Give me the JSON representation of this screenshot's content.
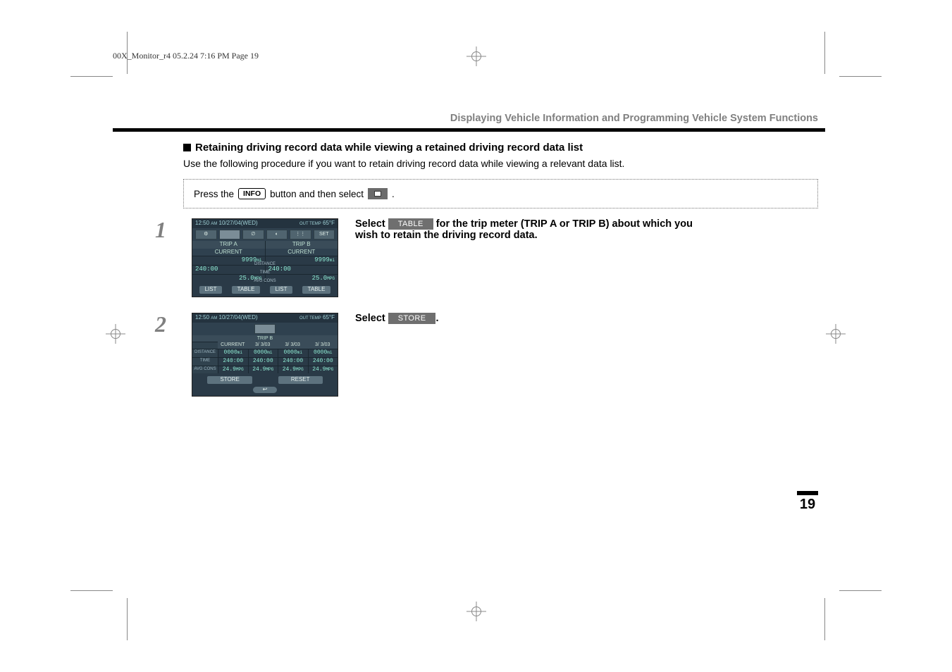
{
  "print_header": "00X_Monitor_r4  05.2.24  7:16 PM  Page 19",
  "chapter_title": "Displaying Vehicle Information and Programming Vehicle System Functions",
  "section_title": "Retaining driving record data while viewing a retained driving record data list",
  "section_intro": "Use the following procedure if you want to retain driving record data while viewing a relevant data list.",
  "instruction": {
    "pre": "Press the ",
    "info_label": "INFO",
    "mid": " button and then select ",
    "post": "."
  },
  "steps": [
    {
      "number": "1",
      "text_pre": "Select ",
      "button_label": "TABLE",
      "text_post_bold_1": " for the trip meter (TRIP A or TRIP B) about which you",
      "text_post_bold_2": "wish to retain the driving record data."
    },
    {
      "number": "2",
      "text_pre": "Select ",
      "button_label": "STORE",
      "text_post": "."
    }
  ],
  "screenshot1": {
    "time": "12:50",
    "ampm": "AM",
    "date": "10/27/04(WED)",
    "temp_label": "OUT TEMP",
    "temp": "65°F",
    "set_label": "SET",
    "trip_a_label": "TRIP A",
    "trip_b_label": "TRIP B",
    "current_label": "CURRENT",
    "rows": {
      "distance_label": "DISTANCE",
      "time_label": "TIME",
      "avgcons_label": "AVG CONS",
      "a_distance": "9999",
      "a_distance_unit": "mi",
      "a_time": "240:00",
      "a_avg": "25.0",
      "a_avg_unit": "MPG",
      "b_distance": "9999",
      "b_distance_unit": "mi",
      "b_time": "240:00",
      "b_avg": "25.0",
      "b_avg_unit": "MPG"
    },
    "btn_list": "LIST",
    "btn_table": "TABLE"
  },
  "screenshot2": {
    "time": "12:50",
    "ampm": "AM",
    "date": "10/27/04(WED)",
    "temp_label": "OUT TEMP",
    "temp": "65°F",
    "trip_b_label": "TRIP B",
    "col_current": "CURRENT",
    "col_dates": [
      "3/ 3/03",
      "3/ 3/03",
      "3/ 3/03"
    ],
    "row_distance_label": "DISTANCE",
    "row_time_label": "TIME",
    "row_avg_label": "AVG CONS",
    "distance_vals": [
      "0000",
      "0000",
      "0000",
      "0000"
    ],
    "distance_unit": "mi",
    "time_vals": [
      "240:00",
      "240:00",
      "240:00",
      "240:00"
    ],
    "avg_vals": [
      "24.9",
      "24.9",
      "24.9",
      "24.9"
    ],
    "avg_unit": "MPG",
    "btn_store": "STORE",
    "btn_reset": "RESET"
  },
  "page_number": "19"
}
